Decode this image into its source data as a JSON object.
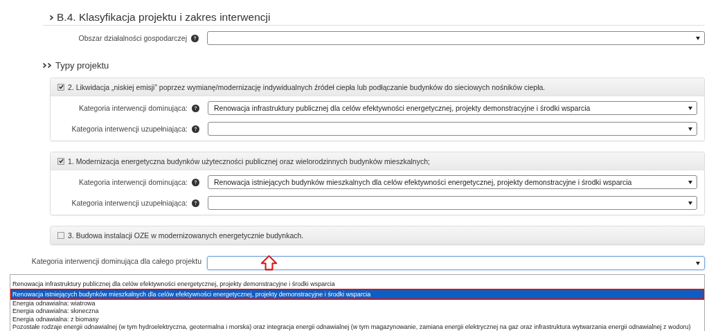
{
  "section": {
    "title": "B.4. Klasyfikacja projektu i zakres interwencji",
    "fields": [
      {
        "label": "Obszar działalności gospodarczej"
      }
    ]
  },
  "project_types": {
    "title": "Typy projektu",
    "panels": [
      {
        "label": "2. Likwidacja „niskiej emisji” poprzez wymianę/modernizację indywidualnych źródeł ciepła lub podłączanie budynków do sieciowych nośników ciepła.",
        "checked": true,
        "fields": [
          {
            "label": "Kategoria interwencji dominująca:",
            "value": "Renowacja infrastruktury publicznej dla celów efektywności energetycznej, projekty demonstracyjne i środki wsparcia"
          },
          {
            "label": "Kategoria interwencji uzupełniająca:"
          }
        ]
      },
      {
        "label": "1. Modernizacja energetyczna budynków użyteczności publicznej oraz wielorodzinnych budynków mieszkalnych;",
        "checked": true,
        "fields": [
          {
            "label": "Kategoria interwencji dominująca:",
            "value": "Renowacja istniejących budynków mieszkalnych dla celów efektywności energetycznej, projekty demonstracyjne i środki wsparcia"
          },
          {
            "label": "Kategoria interwencji uzupełniająca:"
          }
        ]
      },
      {
        "label": "3. Budowa instalacji OZE w modernizowanych energetycznie budynkach.",
        "checked": false
      }
    ]
  },
  "overall_field": {
    "label": "Kategoria interwencji dominująca dla całego projektu",
    "expanded": true,
    "options": [
      {
        "label": "Renowacja infrastruktury publicznej dla celów efektywności energetycznej, projekty demonstracyjne i środki wsparcia",
        "selected": false
      },
      {
        "label": "Renowacja istniejących budynków mieszkalnych dla celów efektywności energetycznej, projekty demonstracyjne i środki wsparcia",
        "selected": true
      },
      {
        "label": "Energia odnawialna: wiatrowa",
        "selected": false
      },
      {
        "label": "Energia odnawialna: słoneczna",
        "selected": false
      },
      {
        "label": "Energia odnawialna: z biomasy",
        "selected": false
      },
      {
        "label": "Pozostałe rodzaje energii odnawialnej (w tym hydroelektryczna, geotermalna i morska) oraz integracja energii odnawialnej (w tym magazynowanie, zamiana energii elektrycznej na gaz oraz infrastruktura wytwarzania energii odnawialnej z wodoru)",
        "selected": false
      }
    ]
  }
}
